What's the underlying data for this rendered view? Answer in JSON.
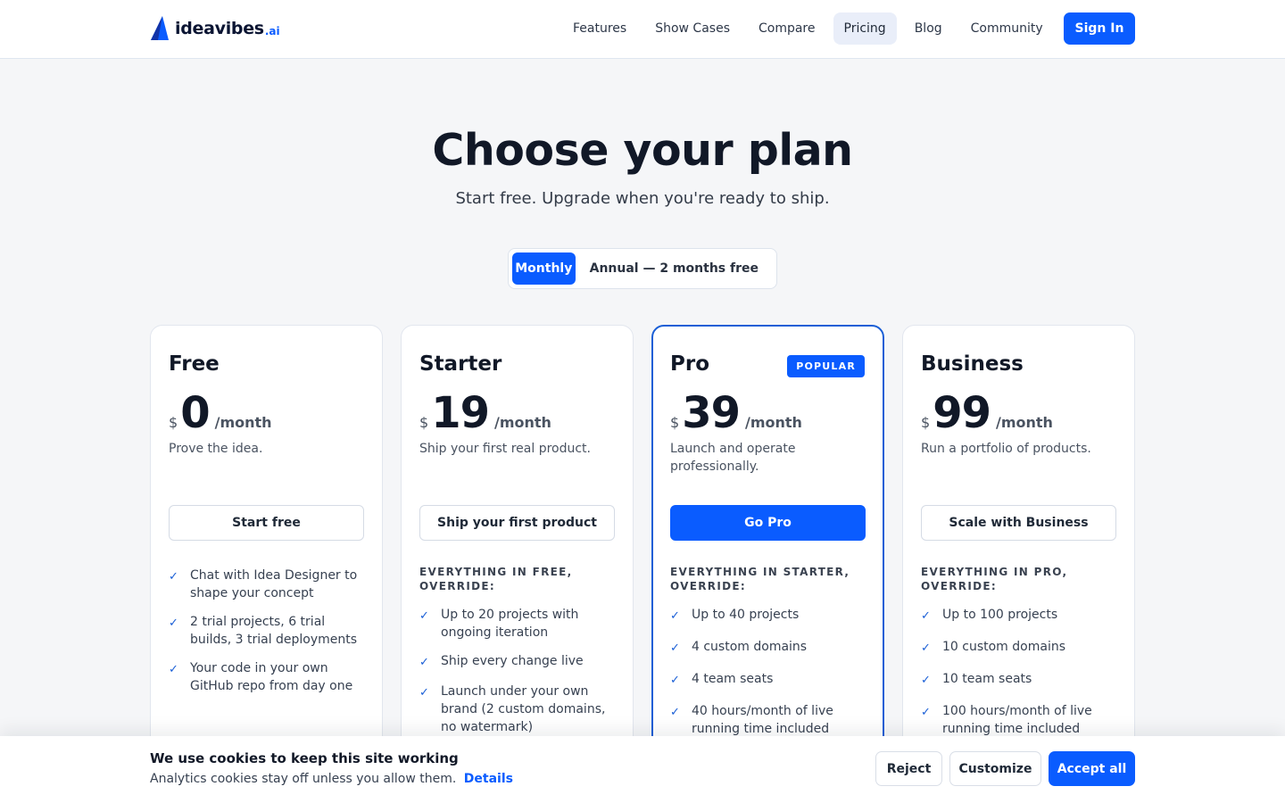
{
  "brand": {
    "name": "ideavibes",
    "suffix": ".ai",
    "logo_icon": "sail-icon",
    "accent_color": "#0a5cff"
  },
  "nav": {
    "items": [
      {
        "label": "Features",
        "active": false
      },
      {
        "label": "Show Cases",
        "active": false
      },
      {
        "label": "Compare",
        "active": false
      },
      {
        "label": "Pricing",
        "active": true
      },
      {
        "label": "Blog",
        "active": false
      },
      {
        "label": "Community",
        "active": false
      }
    ],
    "signin_label": "Sign In"
  },
  "hero": {
    "title": "Choose your plan",
    "subtitle": "Start free. Upgrade when you're ready to ship."
  },
  "billing_toggle": {
    "options": [
      "Monthly",
      "Annual — 2 months free"
    ],
    "selected": "Monthly"
  },
  "plans": [
    {
      "name": "Free",
      "currency": "$",
      "price": "0",
      "period": "/month",
      "tagline": "Prove the idea.",
      "cta": "Start free",
      "features_heading": "",
      "features": [
        "Chat with Idea Designer to shape your concept",
        "2 trial projects, 6 trial builds, 3 trial deployments",
        "Your code in your own GitHub repo from day one"
      ]
    },
    {
      "name": "Starter",
      "currency": "$",
      "price": "19",
      "period": "/month",
      "tagline": "Ship your first real product.",
      "cta": "Ship your first product",
      "features_heading": "EVERYTHING IN FREE, OVERRIDE:",
      "features": [
        "Up to 20 projects with ongoing iteration",
        "Ship every change live",
        "Launch under your own brand (2 custom domains, no watermark)"
      ]
    },
    {
      "name": "Pro",
      "badge": "POPULAR",
      "currency": "$",
      "price": "39",
      "period": "/month",
      "tagline": "Launch and operate professionally.",
      "cta": "Go Pro",
      "features_heading": "EVERYTHING IN STARTER, OVERRIDE:",
      "features": [
        "Up to 40 projects",
        "4 custom domains",
        "4 team seats",
        "40 hours/month of live running time included"
      ]
    },
    {
      "name": "Business",
      "currency": "$",
      "price": "99",
      "period": "/month",
      "tagline": "Run a portfolio of products.",
      "cta": "Scale with Business",
      "features_heading": "EVERYTHING IN PRO, OVERRIDE:",
      "features": [
        "Up to 100 projects",
        "10 custom domains",
        "10 team seats",
        "100 hours/month of live running time included"
      ]
    }
  ],
  "cookie_banner": {
    "title": "We use cookies to keep this site working",
    "text": "Analytics cookies stay off unless you allow them.",
    "link": "Details",
    "reject_label": "Reject",
    "customize_label": "Customize",
    "accept_label": "Accept all"
  }
}
